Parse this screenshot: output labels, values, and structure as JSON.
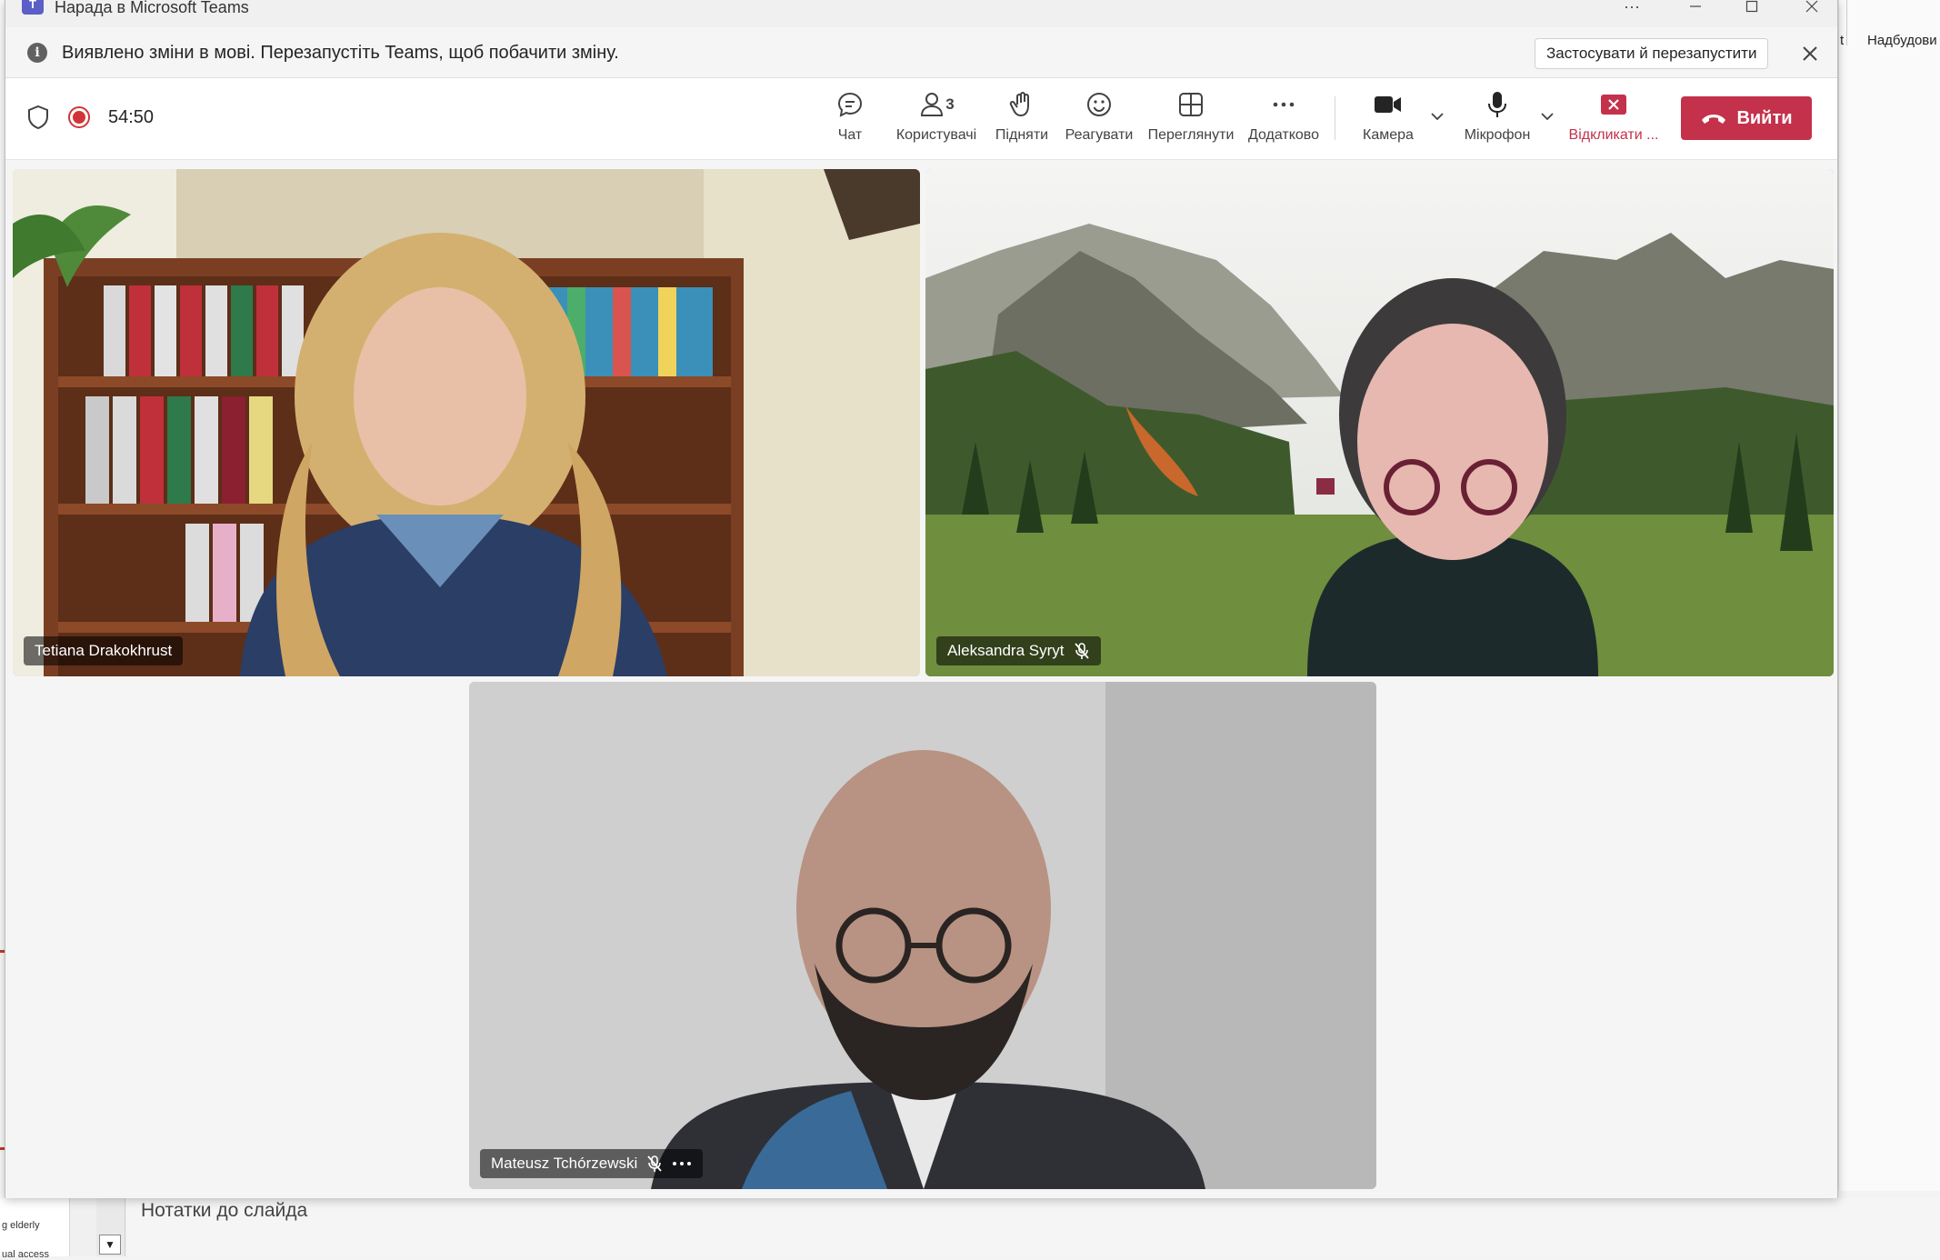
{
  "window": {
    "title": "Нарада в Microsoft Teams",
    "icon_letter": "T"
  },
  "notification": {
    "message": "Виявлено зміни в мові. Перезапустіть Teams, щоб побачити зміну.",
    "apply_label": "Застосувати й перезапустити"
  },
  "toolbar": {
    "timer": "54:50",
    "participant_count": "3",
    "chat": "Чат",
    "people": "Користувачі",
    "raise": "Підняти",
    "react": "Реагувати",
    "view": "Переглянути",
    "more": "Додатково",
    "camera": "Камера",
    "mic": "Мікрофон",
    "unmute_others": "Відкликати ...",
    "leave": "Вийти"
  },
  "participants": [
    {
      "name": "Tetiana Drakokhrust",
      "muted": false
    },
    {
      "name": "Aleksandra Syryt",
      "muted": true
    },
    {
      "name": "Mateusz Tchórzewski",
      "muted": true
    }
  ],
  "background_app": {
    "ribbon_label": "Надбудови",
    "ribbon_fragment": "t",
    "notes_placeholder": "Нотатки до слайда",
    "thumb_text_1": "g elderly",
    "thumb_text_2": "ual access"
  },
  "colors": {
    "leave_red": "#c4314b",
    "teams_purple": "#5b5fc7",
    "recording_red": "#d13438"
  }
}
